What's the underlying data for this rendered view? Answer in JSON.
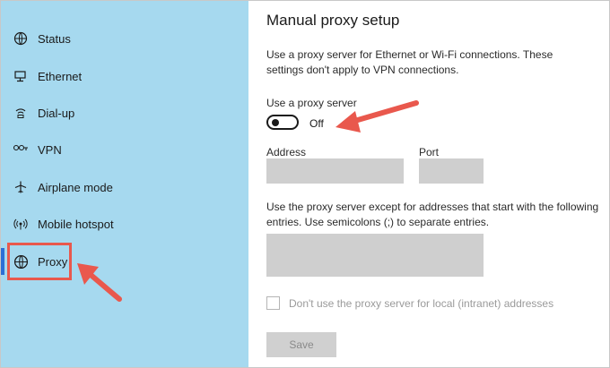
{
  "sidebar": {
    "items": [
      {
        "label": "Status",
        "icon": "globe-status-icon"
      },
      {
        "label": "Ethernet",
        "icon": "ethernet-icon"
      },
      {
        "label": "Dial-up",
        "icon": "dialup-icon"
      },
      {
        "label": "VPN",
        "icon": "vpn-icon"
      },
      {
        "label": "Airplane mode",
        "icon": "airplane-icon"
      },
      {
        "label": "Mobile hotspot",
        "icon": "hotspot-icon"
      },
      {
        "label": "Proxy",
        "icon": "globe-icon"
      }
    ],
    "active": "Proxy"
  },
  "main": {
    "title": "Manual proxy setup",
    "description": "Use a proxy server for Ethernet or Wi-Fi connections. These settings don't apply to VPN connections.",
    "use_proxy_label": "Use a proxy server",
    "toggle_state": "Off",
    "address_label": "Address",
    "port_label": "Port",
    "address_value": "",
    "port_value": "",
    "exceptions_description": "Use the proxy server except for addresses that start with the following entries. Use semicolons (;) to separate entries.",
    "exceptions_value": "",
    "local_checkbox_label": "Don't use the proxy server for local (intranet) addresses",
    "save_label": "Save"
  },
  "colors": {
    "sidebar_bg": "#a6d9ef",
    "accent": "#2d6fd6",
    "annotation_red": "#e9584d",
    "field_bg": "#cfcfcf"
  }
}
